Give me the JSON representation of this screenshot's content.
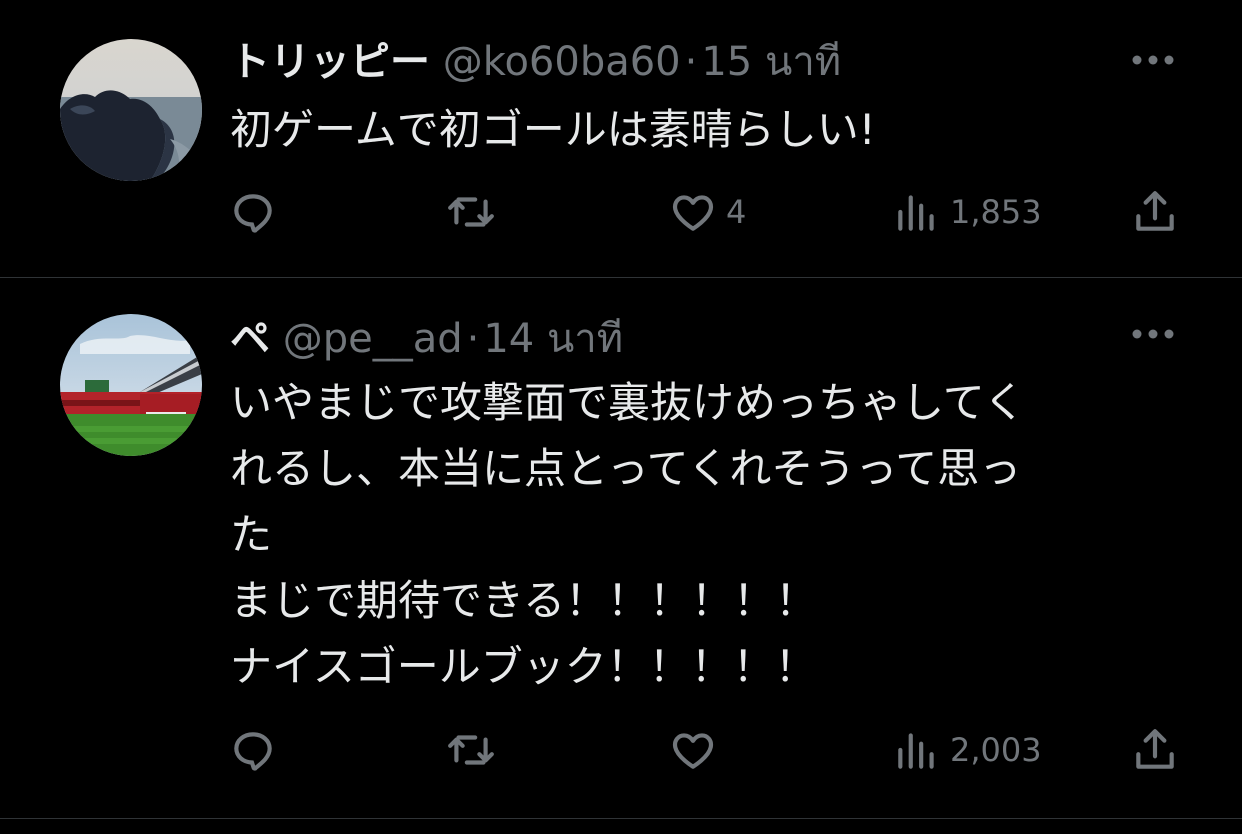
{
  "colors": {
    "background": "#000000",
    "text_primary": "#e7e9ea",
    "text_secondary": "#71767b",
    "divider": "#2f3336"
  },
  "tweets": [
    {
      "display_name": "トリッピー",
      "handle": "@ko60ba60",
      "separator": "·",
      "time": "15 นาที",
      "text": "初ゲームで初ゴールは素晴らしい!",
      "likes": "4",
      "views": "1,853",
      "avatar": "coastal-rocks-photo",
      "icons": [
        "reply-icon",
        "retweet-icon",
        "like-icon",
        "views-icon",
        "share-icon",
        "more-icon"
      ]
    },
    {
      "display_name": "ペ",
      "handle": "@pe__ad",
      "separator": "·",
      "time": "14 นาที",
      "text": "いやまじで攻撃面で裏抜けめっちゃしてく\nれるし、本当に点とってくれそうって思っ\nた\nまじで期待できる！！！！！！\nナイスゴールブック！！！！！",
      "likes": "",
      "views": "2,003",
      "avatar": "stadium-photo",
      "icons": [
        "reply-icon",
        "retweet-icon",
        "like-icon",
        "views-icon",
        "share-icon",
        "more-icon"
      ]
    }
  ]
}
